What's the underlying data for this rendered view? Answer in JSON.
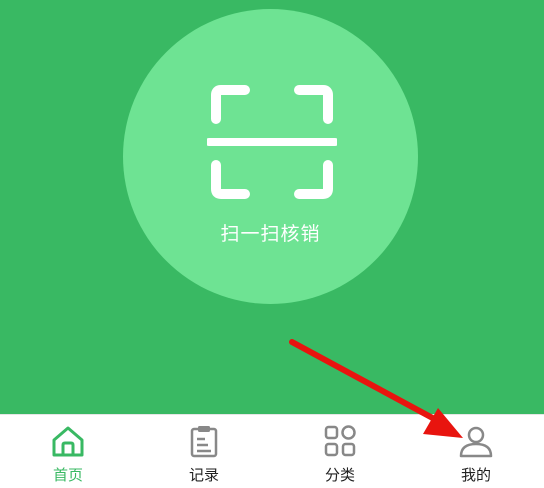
{
  "colors": {
    "primary": "#39b963",
    "scan_circle": "#6ee393",
    "tab_icon_inactive": "#888888",
    "annotation_arrow": "#e8140f"
  },
  "scan": {
    "label": "扫一扫核销",
    "icon": "scan-frame-icon"
  },
  "tabs": [
    {
      "label": "首页",
      "icon": "home-icon",
      "active": true
    },
    {
      "label": "记录",
      "icon": "clipboard-icon",
      "active": false
    },
    {
      "label": "分类",
      "icon": "grid-icon",
      "active": false
    },
    {
      "label": "我的",
      "icon": "user-icon",
      "active": false
    }
  ]
}
